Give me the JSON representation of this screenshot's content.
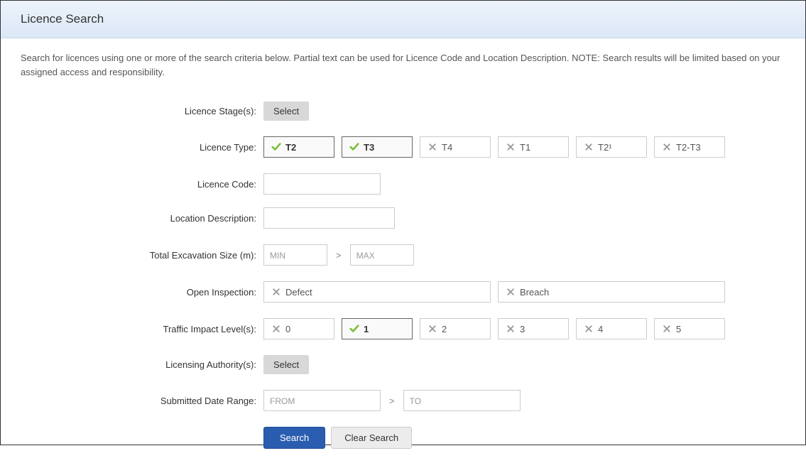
{
  "header": {
    "title": "Licence Search"
  },
  "intro": "Search for licences using one or more of the search criteria below. Partial text can be used for Licence Code and Location Description. NOTE: Search results will be limited based on your assigned access and responsibility.",
  "form": {
    "licence_stage": {
      "label": "Licence Stage(s):",
      "button": "Select"
    },
    "licence_type": {
      "label": "Licence Type:",
      "options": [
        {
          "label": "T2",
          "selected": true
        },
        {
          "label": "T3",
          "selected": true
        },
        {
          "label": "T4",
          "selected": false
        },
        {
          "label": "T1",
          "selected": false
        },
        {
          "label": "T2¹",
          "selected": false
        },
        {
          "label": "T2-T3",
          "selected": false
        }
      ]
    },
    "licence_code": {
      "label": "Licence Code:",
      "value": ""
    },
    "location_description": {
      "label": "Location Description:",
      "value": ""
    },
    "excavation_size": {
      "label": "Total Excavation Size (m):",
      "min_placeholder": "MIN",
      "max_placeholder": "MAX",
      "separator": ">"
    },
    "open_inspection": {
      "label": "Open Inspection:",
      "options": [
        {
          "label": "Defect",
          "selected": false
        },
        {
          "label": "Breach",
          "selected": false
        }
      ]
    },
    "traffic_impact": {
      "label": "Traffic Impact Level(s):",
      "options": [
        {
          "label": "0",
          "selected": false
        },
        {
          "label": "1",
          "selected": true
        },
        {
          "label": "2",
          "selected": false
        },
        {
          "label": "3",
          "selected": false
        },
        {
          "label": "4",
          "selected": false
        },
        {
          "label": "5",
          "selected": false
        }
      ]
    },
    "licensing_authority": {
      "label": "Licensing Authority(s):",
      "button": "Select"
    },
    "submitted_date": {
      "label": "Submitted Date Range:",
      "from_placeholder": "FROM",
      "to_placeholder": "TO",
      "separator": ">"
    },
    "actions": {
      "search": "Search",
      "clear": "Clear Search"
    }
  },
  "icons": {
    "check_color": "#7cbf3a",
    "x_color": "#999"
  }
}
